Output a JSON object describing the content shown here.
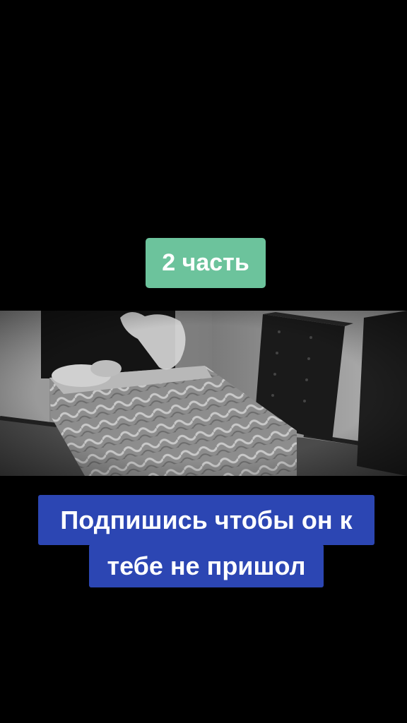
{
  "part_label": "2 часть",
  "caption": {
    "line1": "Подпишись чтобы он к",
    "line2": "тебе не пришол"
  },
  "colors": {
    "background": "#000000",
    "part_badge": "#6cc39c",
    "caption_box": "#2c46b3"
  }
}
